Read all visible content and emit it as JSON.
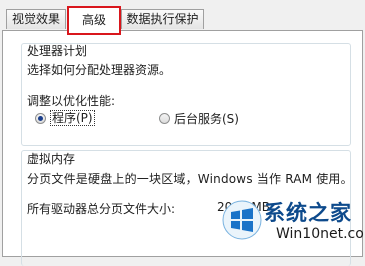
{
  "tabs": [
    {
      "label": "视觉效果"
    },
    {
      "label": "高级"
    },
    {
      "label": "数据执行保护"
    }
  ],
  "processor": {
    "title": "处理器计划",
    "description": "选择如何分配处理器资源。",
    "adjust_label": "调整以优化性能:",
    "options": [
      {
        "label": "程序(P)",
        "selected": true
      },
      {
        "label": "后台服务(S)",
        "selected": false
      }
    ]
  },
  "virtual_memory": {
    "title": "虚拟内存",
    "description": "分页文件是硬盘上的一块区域，Windows 当作 RAM 使用。",
    "total_label": "所有驱动器总分页文件大小:",
    "total_value": "2047 MB"
  },
  "watermark": {
    "title": "系统之家",
    "subtitle": "Win10net.com"
  },
  "colors": {
    "highlight_border": "#d9161c",
    "radio_dot": "#1b3f8c",
    "watermark_blue": "#0d4a8c"
  }
}
